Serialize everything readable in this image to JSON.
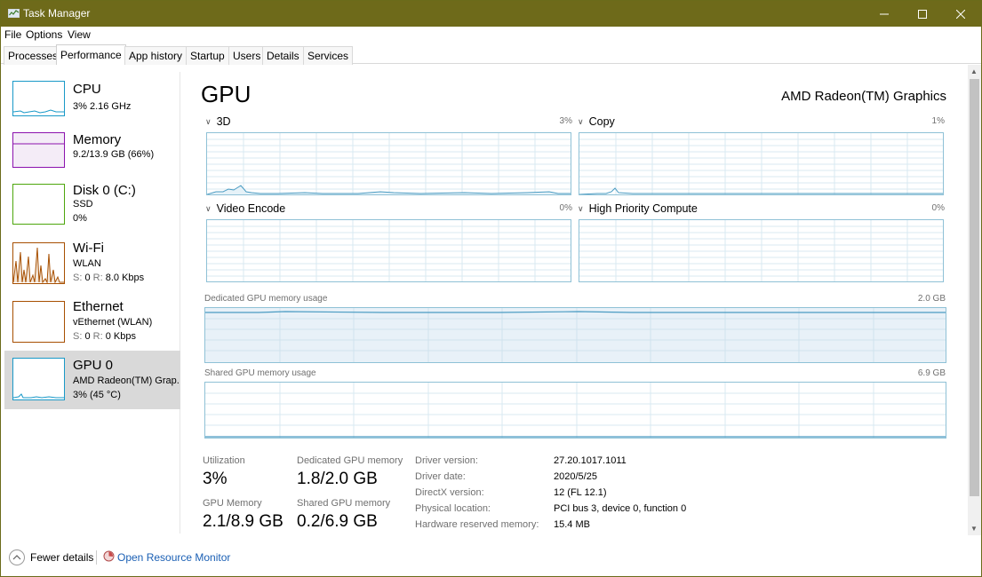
{
  "window": {
    "title": "Task Manager"
  },
  "menu": [
    "File",
    "Options",
    "View"
  ],
  "tabs": [
    "Processes",
    "Performance",
    "App history",
    "Startup",
    "Users",
    "Details",
    "Services"
  ],
  "active_tab": "Performance",
  "sidebar": {
    "items": [
      {
        "name": "CPU",
        "line1": "3% 2.16 GHz",
        "line2": "",
        "color": "#1999c8"
      },
      {
        "name": "Memory",
        "line1": "9.2/13.9 GB (66%)",
        "line2": "",
        "color": "#8b12ae"
      },
      {
        "name": "Disk 0 (C:)",
        "line1": "SSD",
        "line2": "0%",
        "color": "#4da60c"
      },
      {
        "name": "Wi-Fi",
        "line1": "WLAN",
        "line2_prefix": "S:",
        "line2_a": "0",
        "line2_mid": "R:",
        "line2_b": "8.0 Kbps",
        "color": "#a74f01"
      },
      {
        "name": "Ethernet",
        "line1": "vEthernet (WLAN)",
        "line2_prefix": "S:",
        "line2_a": "0",
        "line2_mid": "R:",
        "line2_b": "0 Kbps",
        "color": "#a74f01"
      },
      {
        "name": "GPU 0",
        "line1": "AMD Radeon(TM) Grap...",
        "line2": "3% (45 °C)",
        "color": "#1999c8"
      }
    ]
  },
  "gpu": {
    "title": "GPU",
    "model": "AMD Radeon(TM) Graphics",
    "engines": [
      {
        "label": "3D",
        "percent": "3%"
      },
      {
        "label": "Copy",
        "percent": "1%"
      },
      {
        "label": "Video Encode",
        "percent": "0%"
      },
      {
        "label": "High Priority Compute",
        "percent": "0%"
      }
    ],
    "dedicated_memory": {
      "label": "Dedicated GPU memory usage",
      "max": "2.0 GB"
    },
    "shared_memory": {
      "label": "Shared GPU memory usage",
      "max": "6.9 GB"
    },
    "stats": {
      "utilization_label": "Utilization",
      "utilization_value": "3%",
      "dedicated_label": "Dedicated GPU memory",
      "dedicated_value": "1.8/2.0 GB",
      "gpu_memory_label": "GPU Memory",
      "gpu_memory_value": "2.1/8.9 GB",
      "shared_label": "Shared GPU memory",
      "shared_value": "0.2/6.9 GB"
    },
    "info": [
      {
        "label": "Driver version:",
        "value": "27.20.1017.1011"
      },
      {
        "label": "Driver date:",
        "value": "2020/5/25"
      },
      {
        "label": "DirectX version:",
        "value": "12 (FL 12.1)"
      },
      {
        "label": "Physical location:",
        "value": "PCI bus 3, device 0, function 0"
      },
      {
        "label": "Hardware reserved memory:",
        "value": "15.4 MB"
      }
    ]
  },
  "footer": {
    "fewer_details": "Fewer details",
    "open_monitor": "Open Resource Monitor"
  }
}
